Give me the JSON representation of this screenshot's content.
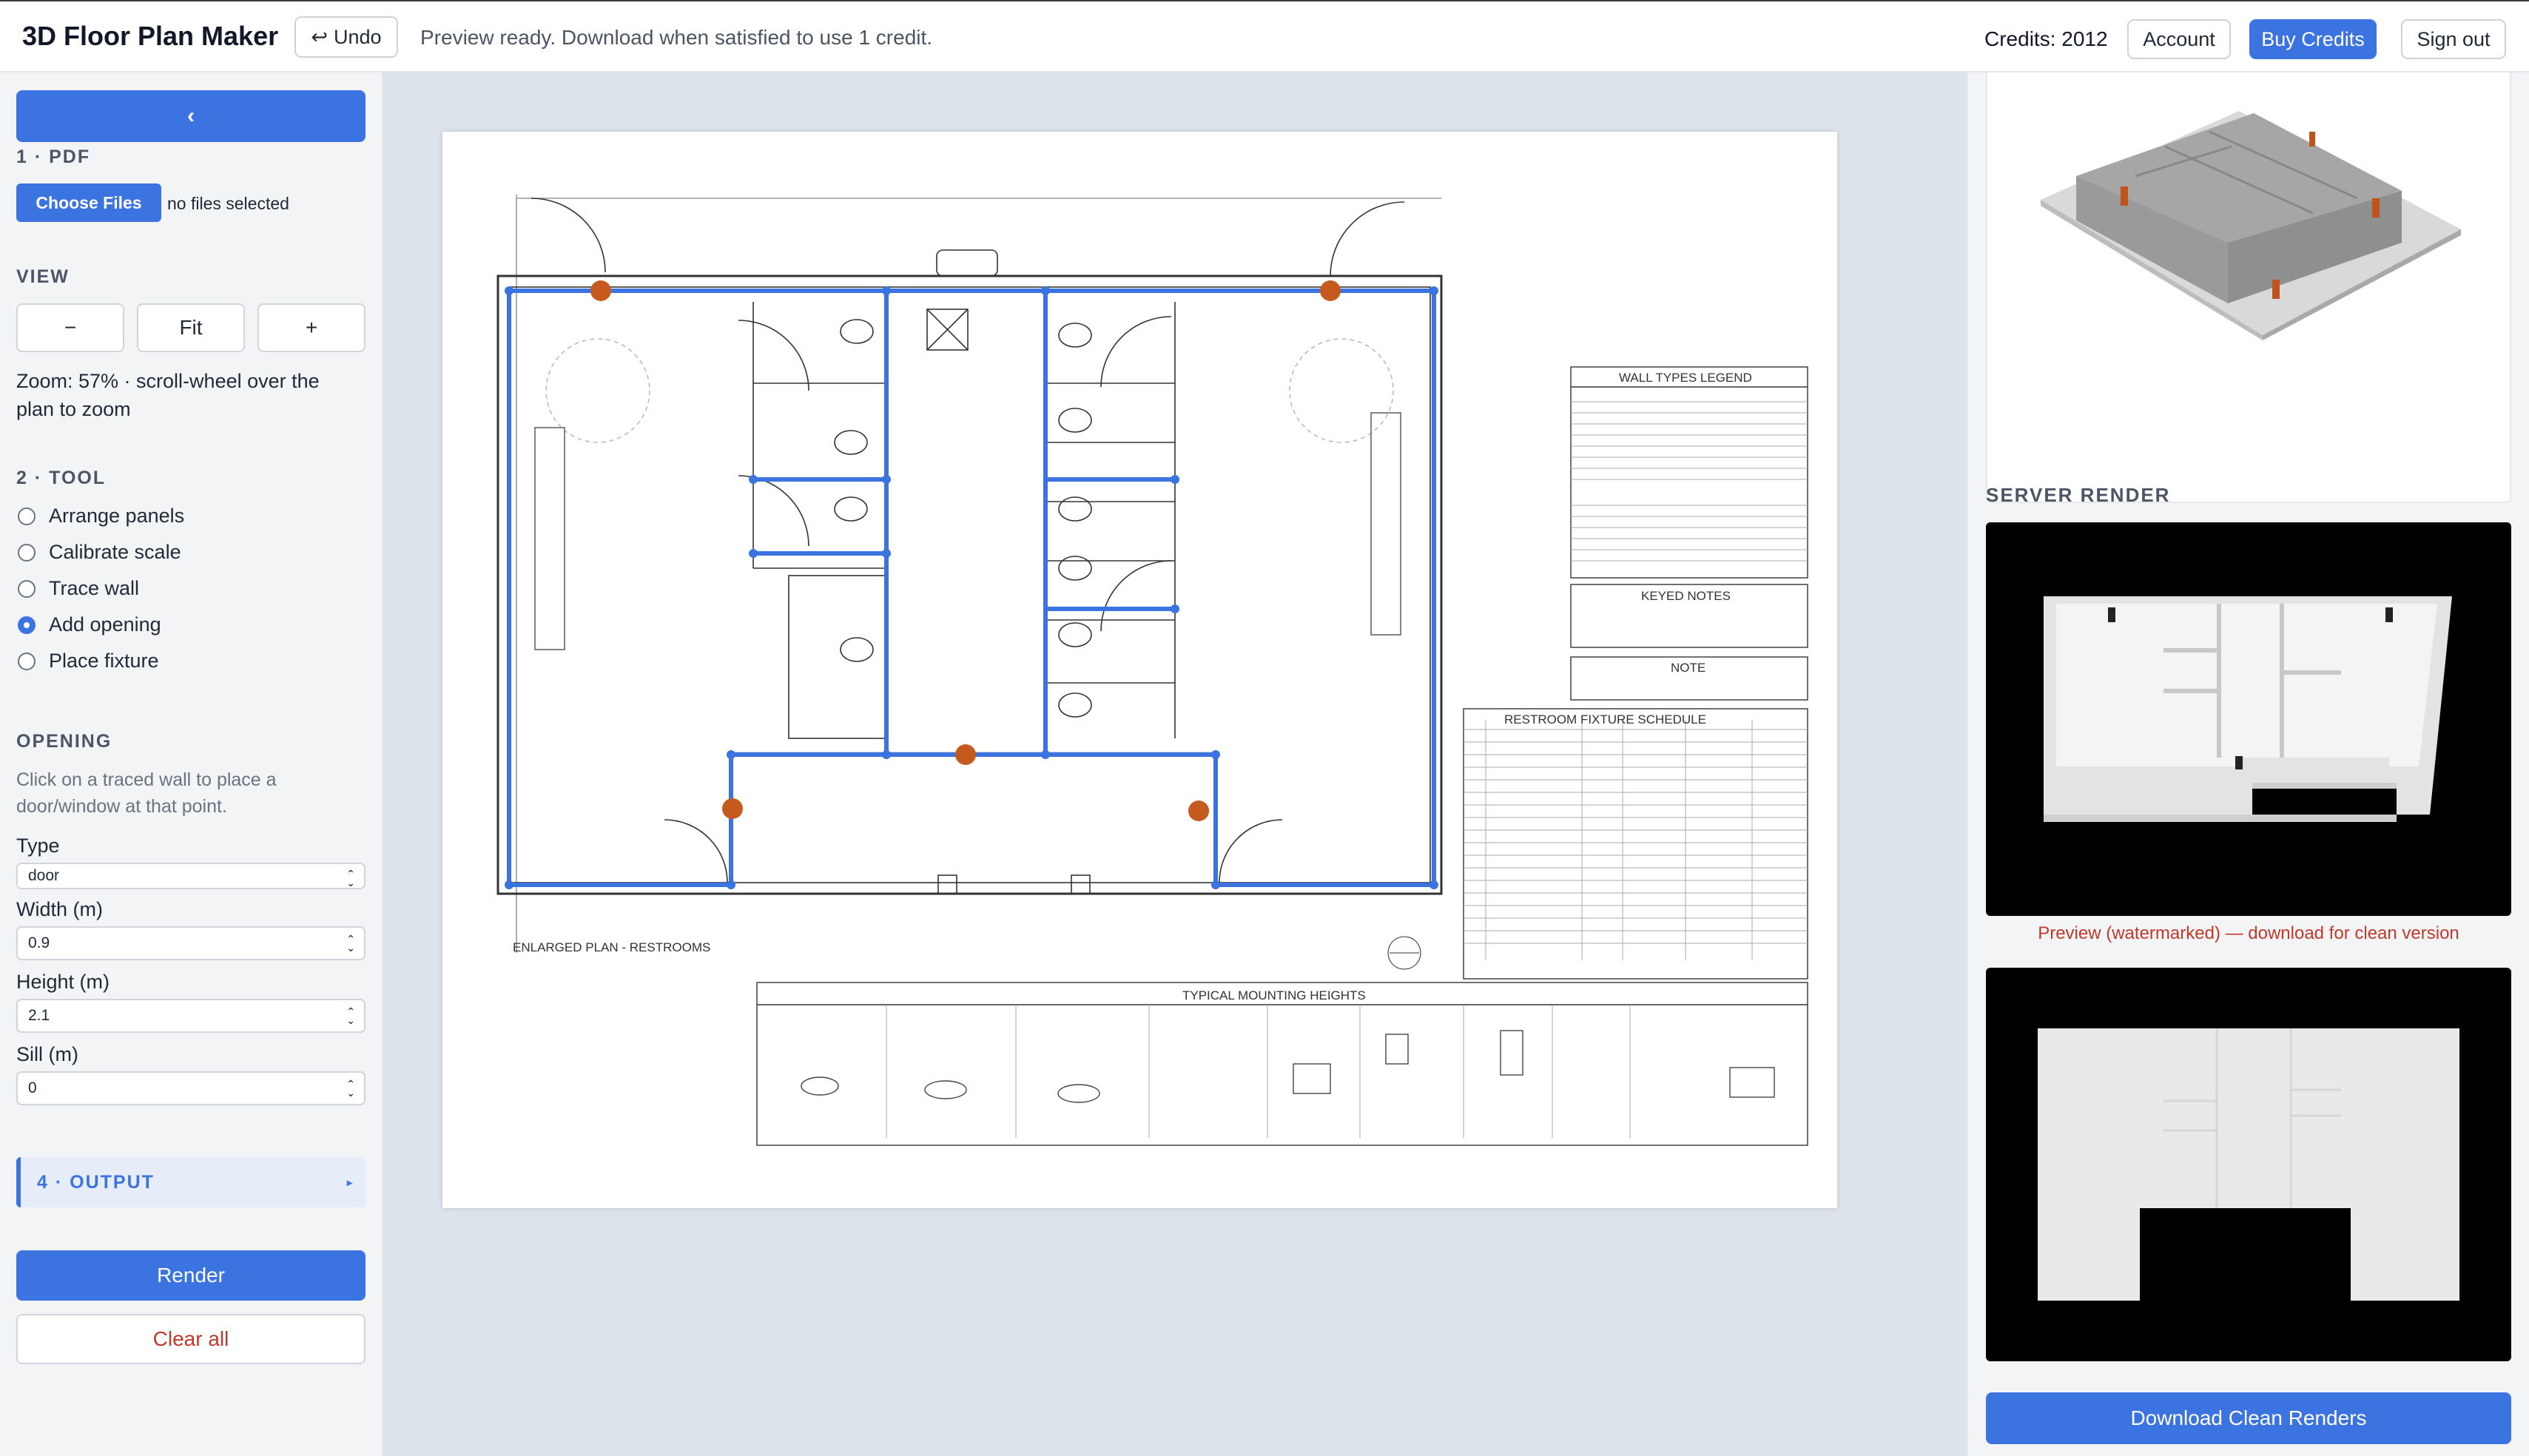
{
  "header": {
    "title": "3D Floor Plan Maker",
    "undo_label": "Undo",
    "undo_icon": "↩",
    "status": "Preview ready. Download when satisfied to use 1 credit.",
    "credits": "Credits: 2012",
    "account_label": "Account",
    "buy_label": "Buy Credits",
    "signout_label": "Sign out"
  },
  "sidebar": {
    "collapse_glyph": "‹",
    "pdf_label": "1 · PDF",
    "choose_files_label": "Choose Files",
    "no_files_text": "no files selected",
    "view_label": "VIEW",
    "zoom_out_label": "−",
    "fit_label": "Fit",
    "zoom_in_label": "+",
    "zoom_text": "Zoom: 57% · scroll-wheel over the plan to zoom",
    "tool_label": "2 · TOOL",
    "tools": [
      {
        "label": "Arrange panels",
        "selected": false
      },
      {
        "label": "Calibrate scale",
        "selected": false
      },
      {
        "label": "Trace wall",
        "selected": false
      },
      {
        "label": "Add opening",
        "selected": true
      },
      {
        "label": "Place fixture",
        "selected": false
      }
    ],
    "opening_label": "OPENING",
    "opening_hint": "Click on a traced wall to place a door/window at that point.",
    "type_label": "Type",
    "type_value": "door",
    "width_label": "Width (m)",
    "width_value": "0.9",
    "height_label": "Height (m)",
    "height_value": "2.1",
    "sill_label": "Sill (m)",
    "sill_value": "0",
    "output_label": "4 · OUTPUT",
    "output_caret": "▸",
    "render_label": "Render",
    "clear_label": "Clear all"
  },
  "plan": {
    "wall_legend_title": "WALL TYPES LEGEND",
    "keyed_notes_title": "KEYED NOTES",
    "note_title": "NOTE",
    "fixture_schedule_title": "RESTROOM FIXTURE SCHEDULE",
    "plan_title": "ENLARGED PLAN - RESTROOMS",
    "mounting_title": "TYPICAL MOUNTING HEIGHTS",
    "trace_color": "#3b73e0",
    "opening_color": "#c65a1e"
  },
  "right": {
    "server_render_label": "SERVER RENDER",
    "watermark_note": "Preview (watermarked) — download for clean version",
    "download_label": "Download Clean Renders"
  },
  "colors": {
    "accent": "#3b73e0",
    "danger": "#c0392b"
  }
}
